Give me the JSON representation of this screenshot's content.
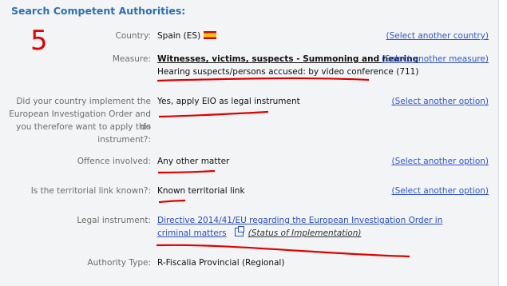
{
  "heading": "Search Competent Authorities:",
  "annotation_number": "5",
  "rows": [
    {
      "label": "Country:",
      "value": "Spain (ES)",
      "action": "(Select another country)"
    },
    {
      "label": "Measure:",
      "value": "Witnesses, victims, suspects - Summoning and hearing",
      "sub": "Hearing suspects/persons accused: by video conference (711)",
      "action": "(Select another measure)"
    },
    {
      "label_lines": [
        "Did your country implement the",
        "European Investigation Order and do",
        "you therefore want to apply this",
        "instrument?:"
      ],
      "value": "Yes, apply EIO as legal instrument",
      "action": "(Select another option)"
    },
    {
      "label": "Offence involved:",
      "value": "Any other matter",
      "action": "(Select another option)"
    },
    {
      "label": "Is the territorial link known?:",
      "value": "Known territorial link",
      "action": "(Select another option)"
    },
    {
      "label": "Legal instrument:",
      "link_line1": "Directive 2014/41/EU regarding the European Investigation Order in",
      "link_line2": "criminal matters",
      "status": "(Status of Implementation)"
    },
    {
      "label": "Authority Type:",
      "value": "R-Fiscalia Provincial (Regional)"
    }
  ],
  "colors": {
    "heading": "#2f6fb0",
    "link": "#3355cc",
    "annotation": "#e00000"
  }
}
